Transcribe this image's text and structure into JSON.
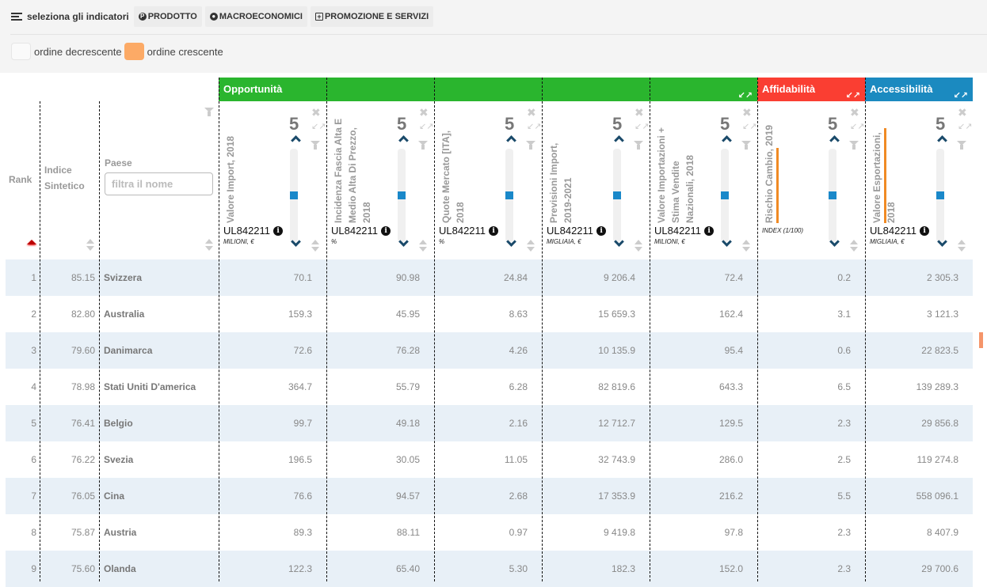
{
  "toolbar": {
    "title": "seleziona gli indicatori",
    "buttons": [
      {
        "label": "PRODOTTO",
        "icon": "product-icon"
      },
      {
        "label": "MACROECONOMICI",
        "icon": "globe-icon"
      },
      {
        "label": "PROMOZIONE E SERVIZI",
        "icon": "plus-square-icon"
      }
    ]
  },
  "legend": {
    "descending": "ordine decrescente",
    "ascending": "ordine crescente",
    "colors": {
      "descending": "#fafafa",
      "ascending": "#fcaa66"
    }
  },
  "groups": [
    {
      "label": "Opportunità",
      "color": "#2ab52e"
    },
    {
      "label": "Affidabilità",
      "color": "#fa3e32"
    },
    {
      "label": "Accessibilità",
      "color": "#1b8ac0"
    }
  ],
  "headers": {
    "rank": "Rank",
    "index": "Indice\nSintetico",
    "country": "Paese",
    "country_filter_placeholder": "filtra il nome"
  },
  "indicators": [
    {
      "title": "Valore Import, 2018",
      "code": "UL842211",
      "unit": "MILIONI, €",
      "weight": "5",
      "group": 0,
      "order": "desc"
    },
    {
      "title": "Incidenza Fascia Alta E\nMedio Alta Di Prezzo,\n2018",
      "code": "UL842211",
      "unit": "%",
      "weight": "5",
      "group": 0,
      "order": "desc"
    },
    {
      "title": "Quote Mercato [ITA],\n2018",
      "code": "UL842211",
      "unit": "%",
      "weight": "5",
      "group": 0,
      "order": "desc"
    },
    {
      "title": "Previsioni Import,\n2019-2021",
      "code": "UL842211",
      "unit": "MIGLIAIA, €",
      "weight": "5",
      "group": 0,
      "order": "desc"
    },
    {
      "title": "Valore Importazioni +\nStima Vendite\nNazionali, 2018",
      "code": "UL842211",
      "unit": "MILIONI, €",
      "weight": "5",
      "group": 0,
      "order": "desc"
    },
    {
      "title": "Rischio Cambio, 2019",
      "code": "",
      "unit": "INDEX (1/100)",
      "weight": "5",
      "group": 1,
      "order": "asc"
    },
    {
      "title": "Valore Esportazioni,\n2018",
      "code": "UL842211",
      "unit": "MIGLIAIA, €",
      "weight": "5",
      "group": 2,
      "order": "asc"
    }
  ],
  "weight_slider_fraction": 0.5,
  "rows": [
    {
      "rank": "1",
      "index": "85.15",
      "country": "Svizzera",
      "values": [
        "70.1",
        "90.98",
        "24.84",
        "9 206.4",
        "72.4",
        "0.2",
        "2 305.3"
      ]
    },
    {
      "rank": "2",
      "index": "82.80",
      "country": "Australia",
      "values": [
        "159.3",
        "45.95",
        "8.63",
        "15 659.3",
        "162.4",
        "3.1",
        "3 121.3"
      ]
    },
    {
      "rank": "3",
      "index": "79.60",
      "country": "Danimarca",
      "values": [
        "72.6",
        "76.28",
        "4.26",
        "10 135.9",
        "95.4",
        "0.6",
        "22 823.5"
      ]
    },
    {
      "rank": "4",
      "index": "78.98",
      "country": "Stati Uniti D'america",
      "values": [
        "364.7",
        "55.79",
        "6.28",
        "82 819.6",
        "643.3",
        "6.5",
        "139 289.3"
      ]
    },
    {
      "rank": "5",
      "index": "76.41",
      "country": "Belgio",
      "values": [
        "99.7",
        "49.18",
        "2.16",
        "12 712.7",
        "129.5",
        "2.3",
        "29 856.8"
      ]
    },
    {
      "rank": "6",
      "index": "76.22",
      "country": "Svezia",
      "values": [
        "196.5",
        "30.05",
        "11.05",
        "32 743.9",
        "286.0",
        "2.5",
        "119 274.8"
      ]
    },
    {
      "rank": "7",
      "index": "76.05",
      "country": "Cina",
      "values": [
        "76.6",
        "94.57",
        "2.68",
        "17 353.9",
        "216.2",
        "5.5",
        "558 096.1"
      ]
    },
    {
      "rank": "8",
      "index": "75.87",
      "country": "Austria",
      "values": [
        "89.3",
        "88.11",
        "0.97",
        "9 419.8",
        "97.8",
        "2.3",
        "8 407.9"
      ]
    },
    {
      "rank": "9",
      "index": "75.60",
      "country": "Olanda",
      "values": [
        "122.3",
        "65.40",
        "5.30",
        "182.3",
        "152.0",
        "2.3",
        "29 700.6"
      ]
    }
  ]
}
